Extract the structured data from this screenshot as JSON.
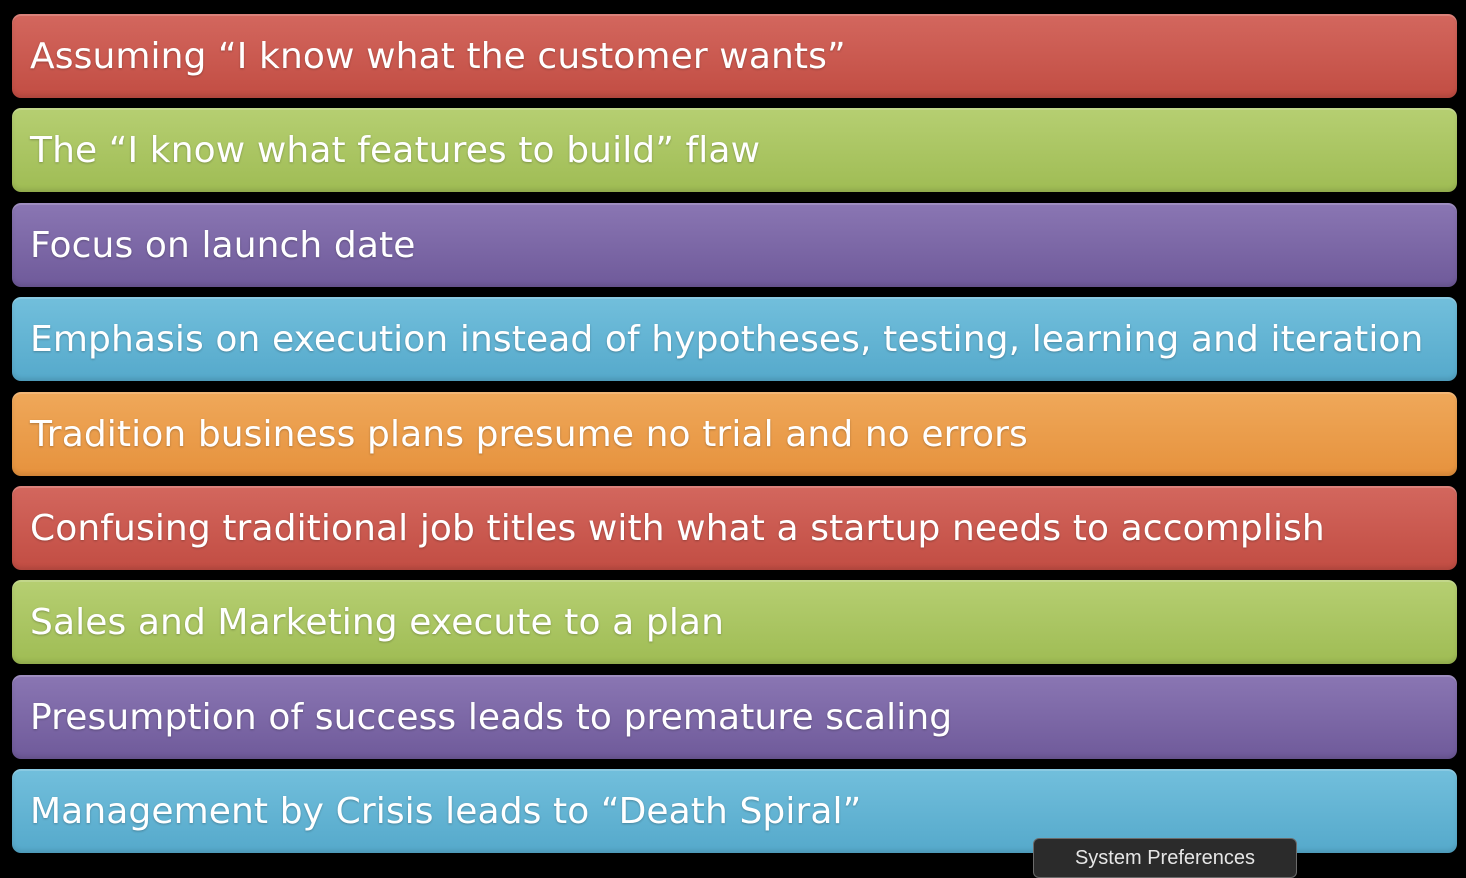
{
  "items": [
    {
      "label": "Assuming “I know what the customer wants”",
      "color": "#c9554b"
    },
    {
      "label": "The “I know what features to build” flaw",
      "color": "#a7c35e"
    },
    {
      "label": "Focus on launch date",
      "color": "#7c65a6"
    },
    {
      "label": "Emphasis on execution instead of hypotheses, testing, learning and iteration",
      "color": "#5fb2d1"
    },
    {
      "label": "Tradition business plans presume no trial and no errors",
      "color": "#eb9a48"
    },
    {
      "label": "Confusing traditional job titles with what a startup needs to accomplish",
      "color": "#c9554b"
    },
    {
      "label": "Sales and Marketing execute to a plan",
      "color": "#a7c35e"
    },
    {
      "label": "Presumption of success leads to premature scaling",
      "color": "#7c65a6"
    },
    {
      "label": "Management by Crisis leads to “Death Spiral”",
      "color": "#5fb2d1"
    }
  ],
  "tooltip": {
    "label": "System Preferences"
  }
}
